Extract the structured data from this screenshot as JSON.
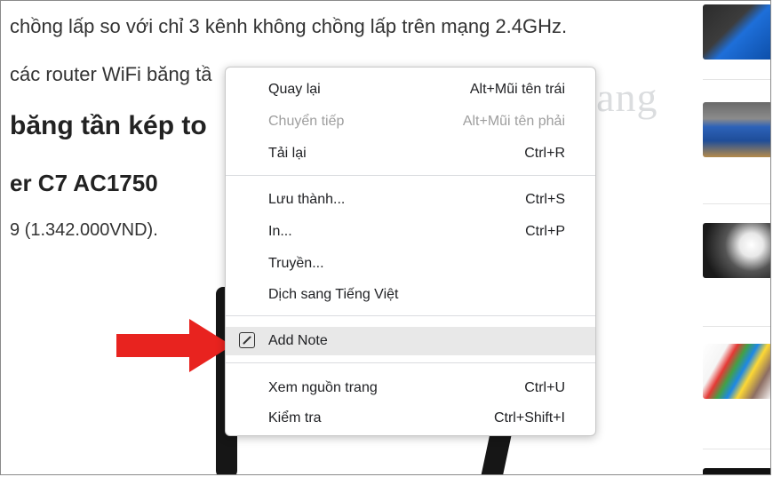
{
  "article": {
    "line1": "chồng lấp so với chỉ 3 kênh không chồng lấp trên mạng 2.4GHz.",
    "line2": "các router WiFi băng tầ",
    "heading": "băng tần kép to",
    "subheading": "er C7 AC1750",
    "price": "9 (1.342.000VND)."
  },
  "watermark": {
    "text": "uantrimang"
  },
  "sidebar": {
    "thumbnails": [
      "router-thumbnail",
      "linksys-router-thumbnail",
      "wifi-signal-thumbnail",
      "network-cables-thumbnail",
      "dark-thumbnail"
    ]
  },
  "context_menu": {
    "items": [
      {
        "label": "Quay lại",
        "shortcut": "Alt+Mũi tên trái",
        "enabled": true
      },
      {
        "label": "Chuyển tiếp",
        "shortcut": "Alt+Mũi tên phải",
        "enabled": false
      },
      {
        "label": "Tải lại",
        "shortcut": "Ctrl+R",
        "enabled": true
      },
      {
        "label": "Lưu thành...",
        "shortcut": "Ctrl+S",
        "enabled": true
      },
      {
        "label": "In...",
        "shortcut": "Ctrl+P",
        "enabled": true
      },
      {
        "label": "Truyền...",
        "shortcut": "",
        "enabled": true
      },
      {
        "label": "Dịch sang Tiếng Việt",
        "shortcut": "",
        "enabled": true
      },
      {
        "label": "Add Note",
        "shortcut": "",
        "enabled": true,
        "highlighted": true,
        "icon": "note-icon"
      },
      {
        "label": "Xem nguồn trang",
        "shortcut": "Ctrl+U",
        "enabled": true
      },
      {
        "label": "Kiểm tra",
        "shortcut": "Ctrl+Shift+I",
        "enabled": true
      }
    ]
  },
  "colors": {
    "arrow": "#e8231f",
    "highlight": "#e8e8e8",
    "disabled_text": "#9e9e9e"
  }
}
